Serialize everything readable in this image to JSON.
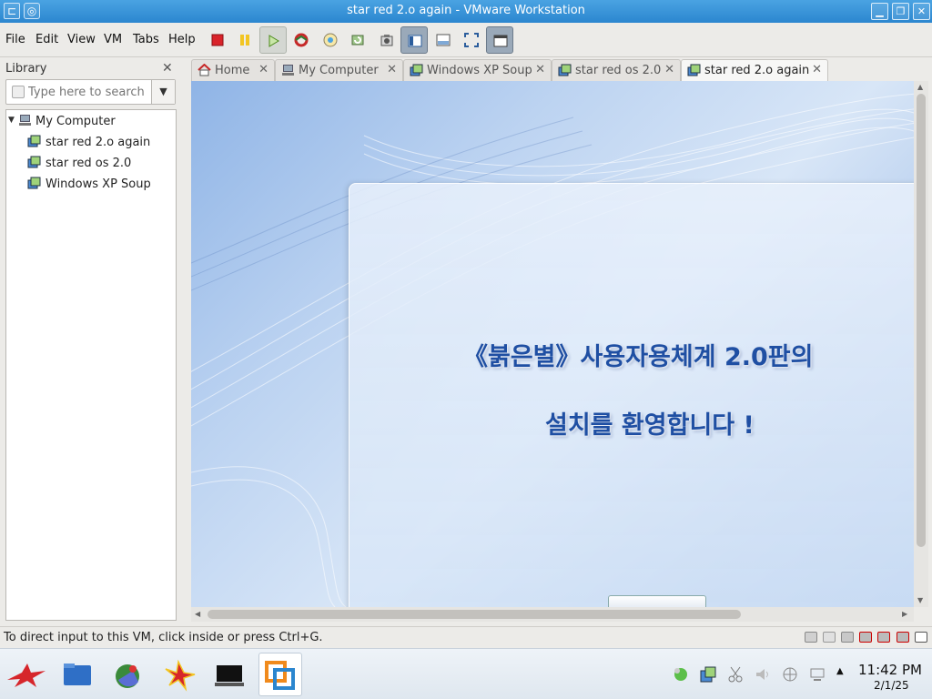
{
  "window": {
    "title": "star red 2.o again - VMware Workstation"
  },
  "menu": [
    "File",
    "Edit",
    "View",
    "VM",
    "Tabs",
    "Help"
  ],
  "library": {
    "header": "Library",
    "search_placeholder": "Type here to search",
    "root": "My Computer",
    "items": [
      "star red 2.o again",
      "star red os 2.0",
      "Windows XP Soup"
    ]
  },
  "tabs": [
    {
      "label": "Home",
      "icon": "home-icon"
    },
    {
      "label": "My Computer",
      "icon": "computer-icon"
    },
    {
      "label": "Windows XP Soup",
      "icon": "vm-icon"
    },
    {
      "label": "star red os 2.0",
      "icon": "vm-icon"
    },
    {
      "label": "star red 2.o again",
      "icon": "vm-icon",
      "active": true
    }
  ],
  "vm_screen": {
    "line1": "《붉은별》사용자용체계 2.0판의",
    "line2": "설치를 환영합니다 !"
  },
  "status": {
    "message": "To direct input to this VM, click inside or press Ctrl+G."
  },
  "clock": {
    "time": "11:42 PM",
    "date": "2/1/25"
  },
  "colors": {
    "titlebar": "#2b86cf",
    "welcome_text": "#1f4fa3"
  }
}
